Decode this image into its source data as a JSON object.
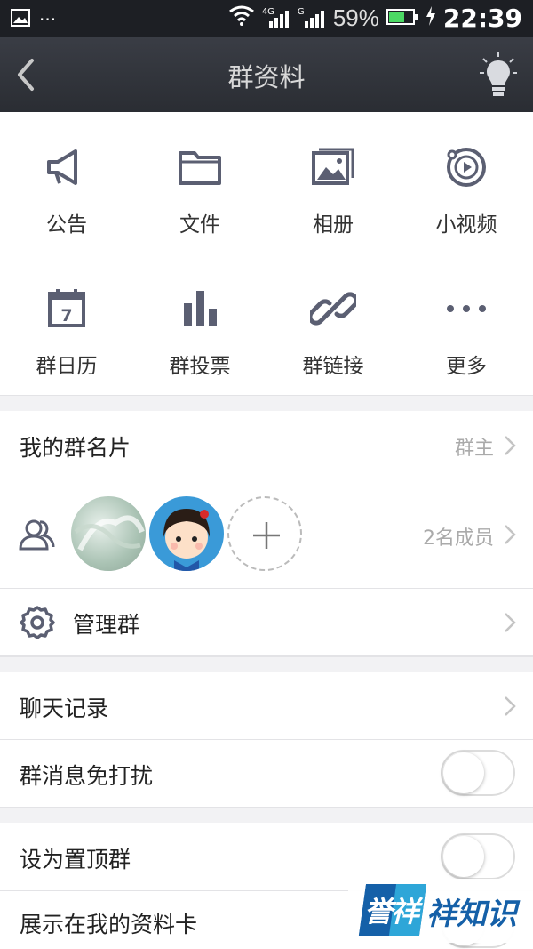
{
  "status_bar": {
    "network_4g": "4G",
    "network_g": "G",
    "battery_percent": "59%",
    "time": "22:39"
  },
  "nav": {
    "title": "群资料"
  },
  "features": [
    {
      "label": "公告",
      "icon": "megaphone-icon"
    },
    {
      "label": "文件",
      "icon": "folder-icon"
    },
    {
      "label": "相册",
      "icon": "photo-album-icon"
    },
    {
      "label": "小视频",
      "icon": "video-icon"
    },
    {
      "label": "群日历",
      "icon": "calendar-icon",
      "day": "7"
    },
    {
      "label": "群投票",
      "icon": "vote-bars-icon"
    },
    {
      "label": "群链接",
      "icon": "link-icon"
    },
    {
      "label": "更多",
      "icon": "more-dots-icon"
    }
  ],
  "my_card": {
    "label": "我的群名片",
    "value": "群主"
  },
  "members": {
    "count_label": "2名成员"
  },
  "manage": {
    "label": "管理群"
  },
  "chat_history": {
    "label": "聊天记录"
  },
  "toggles": [
    {
      "label": "群消息免打扰",
      "on": false
    },
    {
      "label": "设为置顶群",
      "on": false
    },
    {
      "label": "展示在我的资料卡",
      "on": false
    }
  ],
  "watermark": {
    "badge_text": "誉祥",
    "text": "祥知识"
  },
  "colors": {
    "icon": "#5b5f72",
    "statusbar": "#1d1f24",
    "navbar": "#2f3238",
    "badge_blue": "#1560a8",
    "badge_cyan": "#2ea6d8"
  }
}
